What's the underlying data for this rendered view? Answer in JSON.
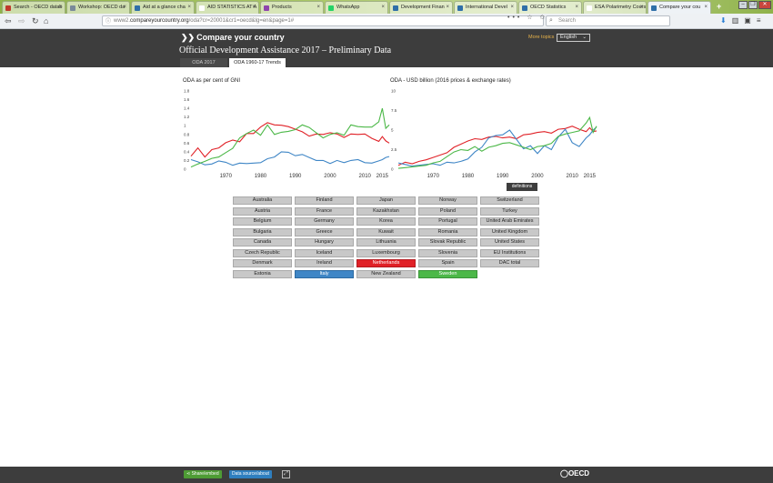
{
  "browser": {
    "tabs": [
      {
        "label": "Search - OECD datab",
        "fav": "#c0392b",
        "active": false
      },
      {
        "label": "Workshop: OECD da",
        "fav": "#7a8a99",
        "active": false
      },
      {
        "label": "Aid at a glance cha",
        "fav": "#2f6fa8",
        "active": false
      },
      {
        "label": "AID STATISTICS AT A",
        "fav": "#ffffff",
        "active": false
      },
      {
        "label": "Products",
        "fav": "#8e44ad",
        "active": false
      },
      {
        "label": "WhatsApp",
        "fav": "#25d366",
        "active": false
      },
      {
        "label": "Development Finan",
        "fav": "#2f6fa8",
        "active": false
      },
      {
        "label": "International Devel",
        "fav": "#2f6fa8",
        "active": false
      },
      {
        "label": "OECD Statistics",
        "fav": "#2f6fa8",
        "active": false
      },
      {
        "label": "ESA Polarimetry Cours",
        "fav": "#ffffff",
        "active": false
      },
      {
        "label": "Compare your cou",
        "fav": "#2f6fa8",
        "active": true
      }
    ],
    "new_tab": "+",
    "url_prefix": "www2.",
    "url_domain": "compareyourcountry.org",
    "url_path": "/oda?cr=20001&cr1=oecd&lg=en&page=1#",
    "search_placeholder": "Search",
    "url_icons": "••• ☆ ✩"
  },
  "site": {
    "logo": "Compare your country",
    "more_topics": "More topics",
    "language": "English",
    "page_title": "Official Development Assistance 2017 – Preliminary Data",
    "tabs": [
      "ODA 2017",
      "ODA 1960-17 Trends"
    ],
    "definitions": "definitions"
  },
  "countries": [
    [
      "Australia",
      "Austria",
      "Belgium",
      "Bulgaria",
      "Canada",
      "Czech Republic",
      "Denmark",
      "Estonia"
    ],
    [
      "Finland",
      "France",
      "Germany",
      "Greece",
      "Hungary",
      "Iceland",
      "Ireland",
      "Italy"
    ],
    [
      "Japan",
      "Kazakhstan",
      "Korea",
      "Kuwait",
      "Lithuania",
      "Luxembourg",
      "Netherlands",
      "New Zealand"
    ],
    [
      "Norway",
      "Poland",
      "Portugal",
      "Romania",
      "Slovak Republic",
      "Slovenia",
      "Spain",
      "Sweden"
    ],
    [
      "Switzerland",
      "Turkey",
      "United Arab Emirates",
      "United Kingdom",
      "United States",
      "EU Institutions",
      "DAC total"
    ]
  ],
  "selected": {
    "Netherlands": "#e02127",
    "Italy": "#3f86c6",
    "Sweden": "#4cb848"
  },
  "footer": {
    "share": "Share/embed",
    "data": "Data source/about",
    "brand": "OECD"
  },
  "chart_data": [
    {
      "type": "line",
      "title": "ODA as per cent of GNI",
      "ylim": [
        0,
        1.8
      ],
      "yticks": [
        "0",
        "0.2",
        "0.4",
        "0.6",
        "0.8",
        "1",
        "1.2",
        "1.4",
        "1.6",
        "1.8"
      ],
      "xlim": [
        1960,
        2017
      ],
      "xticks": [
        1970,
        1980,
        1990,
        2000,
        2010,
        2015
      ],
      "x": [
        1960,
        1962,
        1964,
        1966,
        1968,
        1970,
        1972,
        1974,
        1976,
        1978,
        1980,
        1982,
        1984,
        1986,
        1988,
        1990,
        1992,
        1994,
        1996,
        1998,
        2000,
        2002,
        2004,
        2006,
        2008,
        2010,
        2012,
        2014,
        2015,
        2016,
        2017
      ],
      "series": [
        {
          "name": "Netherlands",
          "color": "#e02127",
          "values": [
            0.3,
            0.49,
            0.28,
            0.45,
            0.49,
            0.61,
            0.67,
            0.63,
            0.82,
            0.82,
            0.97,
            1.07,
            1.02,
            1.01,
            0.98,
            0.92,
            0.86,
            0.76,
            0.81,
            0.8,
            0.84,
            0.81,
            0.73,
            0.81,
            0.8,
            0.81,
            0.71,
            0.64,
            0.75,
            0.65,
            0.6
          ]
        },
        {
          "name": "Italy",
          "color": "#3f86c6",
          "values": [
            0.22,
            0.17,
            0.1,
            0.12,
            0.19,
            0.16,
            0.09,
            0.14,
            0.13,
            0.14,
            0.15,
            0.24,
            0.28,
            0.4,
            0.39,
            0.31,
            0.34,
            0.27,
            0.2,
            0.2,
            0.13,
            0.2,
            0.15,
            0.2,
            0.22,
            0.15,
            0.14,
            0.19,
            0.22,
            0.27,
            0.29
          ]
        },
        {
          "name": "Sweden",
          "color": "#4cb848",
          "values": [
            0.05,
            0.12,
            0.18,
            0.25,
            0.28,
            0.38,
            0.48,
            0.72,
            0.82,
            0.9,
            0.78,
            1.02,
            0.8,
            0.85,
            0.87,
            0.91,
            1.02,
            0.96,
            0.84,
            0.72,
            0.8,
            0.84,
            0.78,
            1.02,
            0.98,
            0.97,
            0.97,
            1.09,
            1.4,
            0.94,
            1.02
          ]
        }
      ]
    },
    {
      "type": "line",
      "title": "ODA - USD billion (2016 prices & exchange rates)",
      "ylim": [
        0,
        10
      ],
      "yticks": [
        "0",
        "2.5",
        "5",
        "7.5",
        "10"
      ],
      "xlim": [
        1960,
        2017
      ],
      "xticks": [
        1970,
        1980,
        1990,
        2000,
        2010,
        2015
      ],
      "x": [
        1960,
        1962,
        1964,
        1966,
        1968,
        1970,
        1972,
        1974,
        1976,
        1978,
        1980,
        1982,
        1984,
        1986,
        1988,
        1990,
        1992,
        1994,
        1996,
        1998,
        2000,
        2002,
        2004,
        2006,
        2008,
        2010,
        2012,
        2014,
        2015,
        2016,
        2017
      ],
      "series": [
        {
          "name": "Netherlands",
          "color": "#e02127",
          "values": [
            0.5,
            0.9,
            0.7,
            1.0,
            1.2,
            1.5,
            1.8,
            2.1,
            2.8,
            3.2,
            3.6,
            3.9,
            3.8,
            4.1,
            4.2,
            4.0,
            4.1,
            3.9,
            4.4,
            4.5,
            4.7,
            4.8,
            4.6,
            5.1,
            5.2,
            5.5,
            5.1,
            4.8,
            5.3,
            4.8,
            4.9
          ]
        },
        {
          "name": "Italy",
          "color": "#3f86c6",
          "values": [
            0.8,
            0.6,
            0.4,
            0.5,
            0.6,
            0.7,
            0.5,
            0.9,
            0.8,
            1.0,
            1.3,
            2.2,
            2.8,
            4.0,
            4.3,
            4.4,
            5.0,
            3.8,
            2.6,
            3.0,
            2.0,
            3.0,
            2.5,
            4.1,
            5.1,
            3.4,
            2.9,
            4.0,
            4.4,
            5.0,
            5.4
          ]
        },
        {
          "name": "Sweden",
          "color": "#4cb848",
          "values": [
            0.1,
            0.2,
            0.3,
            0.4,
            0.5,
            0.8,
            1.0,
            1.6,
            2.2,
            2.5,
            2.4,
            2.9,
            2.3,
            2.8,
            3.0,
            3.3,
            3.4,
            3.1,
            2.8,
            2.5,
            2.9,
            3.0,
            3.3,
            4.2,
            4.5,
            4.7,
            4.9,
            5.9,
            6.6,
            4.7,
            5.5
          ]
        }
      ]
    }
  ]
}
